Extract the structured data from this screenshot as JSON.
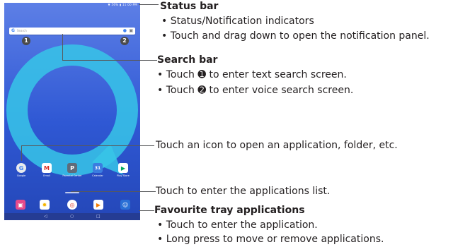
{
  "screen": {
    "status_icons": "▼ 56% ▮ 11:00 PM",
    "search_hint": "Search",
    "callout_1": "1",
    "callout_2": "2",
    "apps": [
      {
        "label": "Google",
        "color": "#e8eaed",
        "glyph": "G"
      },
      {
        "label": "Email",
        "color": "#ffffff",
        "glyph": "M"
      },
      {
        "label": "Parental Center",
        "color": "#5f6b7a",
        "glyph": "P"
      },
      {
        "label": "Calendar",
        "color": "#3b7de0",
        "glyph": "31"
      },
      {
        "label": "Play Store",
        "color": "#ffffff",
        "glyph": "▶"
      }
    ],
    "tray": [
      {
        "name": "camera",
        "color": "#e64a8b",
        "glyph": "▣"
      },
      {
        "name": "photos",
        "color": "#ffffff",
        "glyph": "✹"
      },
      {
        "name": "chrome",
        "color": "#ffffff",
        "glyph": "◎"
      },
      {
        "name": "video",
        "color": "#ffffff",
        "glyph": "▶"
      },
      {
        "name": "contacts",
        "color": "#2a6fd6",
        "glyph": "☺"
      }
    ],
    "nav": [
      "◁",
      "○",
      "□"
    ]
  },
  "annotations": {
    "status_bar": {
      "title": "Status bar",
      "bullets": [
        "• Status/Notification indicators",
        "• Touch and drag down to open the notification panel."
      ]
    },
    "search_bar": {
      "title": "Search bar",
      "bullets": [
        "• Touch ➊ to enter text search screen.",
        "• Touch ➋ to enter voice search screen."
      ]
    },
    "icons_note": "Touch an icon to open an application, folder, etc.",
    "apps_list_note": "Touch to enter the applications list.",
    "favourite_tray": {
      "title": "Favourite tray applications",
      "bullets": [
        "• Touch to enter the application.",
        "• Long press to move or remove applications."
      ]
    }
  }
}
